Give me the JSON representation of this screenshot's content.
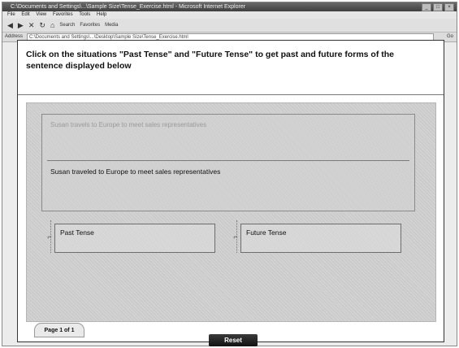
{
  "window": {
    "title": "C:\\Documents and Settings\\...\\Sample Size\\Tense_Exercise.html - Microsoft Internet Explorer",
    "controls": [
      "_",
      "□",
      "×"
    ]
  },
  "menubar": {
    "items": [
      "File",
      "Edit",
      "View",
      "Favorites",
      "Tools",
      "Help"
    ]
  },
  "toolbar": {
    "back": "◀",
    "forward": "▶",
    "stop": "✕",
    "refresh": "↻",
    "home": "⌂",
    "search_label": "Search",
    "favorites_label": "Favorites",
    "media_label": "Media"
  },
  "addressbar": {
    "label": "Address",
    "url": "C:\\Documents and Settings\\...\\Desktop\\Sample Size\\Tense_Exercise.html",
    "go": "Go"
  },
  "exercise": {
    "instructions": "Click on the situations \"Past Tense\" and \"Future Tense\" to get past and future forms of the sentence displayed below",
    "sentence_ghost": "Susan travels to Europe to meet sales representatives",
    "sentence_main": "Susan traveled to Europe to meet sales representatives",
    "past_label": "Past Tense",
    "future_label": "Future Tense",
    "page_label": "Page 1 of 1",
    "reset_label": "Reset"
  },
  "colors": {
    "stage_bg": "#d2d2d2",
    "title_bar": "#4a4a4a",
    "reset_bg": "#1a1a1a"
  }
}
